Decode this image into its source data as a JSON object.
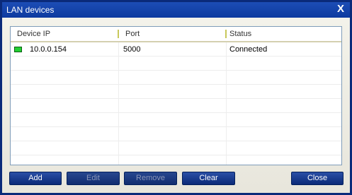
{
  "window": {
    "title": "LAN devices",
    "close_glyph": "X"
  },
  "table": {
    "columns": [
      "Device IP",
      "Port",
      "Status"
    ],
    "rows": [
      {
        "ip": "10.0.0.154",
        "port": "5000",
        "status": "Connected",
        "status_color": "#23cf32"
      }
    ]
  },
  "buttons": {
    "add": "Add",
    "edit": "Edit",
    "remove": "Remove",
    "clear": "Clear",
    "close": "Close"
  },
  "colors": {
    "titlebar": "#1c4db6",
    "button": "#1a3f92",
    "connected_led": "#23cf32"
  }
}
